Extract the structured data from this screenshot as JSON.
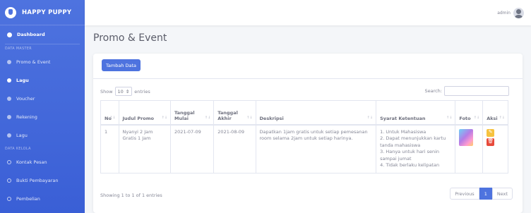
{
  "brand": {
    "name": "HAPPY PUPPY",
    "icon": "dog-icon"
  },
  "sidebar": {
    "dashboard": "Dashboard",
    "section_master": "DATA MASTER",
    "items": [
      "Promo & Event",
      "Lagu",
      "Voucher",
      "Rekening",
      "Lagu"
    ],
    "section_kelola": "DATA KELOLA",
    "kelola_items": [
      "Kontak Pesan",
      "Bukti Pembayaran",
      "Pembelian"
    ]
  },
  "topbar": {
    "user": "admin"
  },
  "page": {
    "title": "Promo & Event"
  },
  "toolbar": {
    "add_label": "Tambah Data"
  },
  "table_controls": {
    "show_label": "Show",
    "entries_value": "10",
    "entries_label": "entries",
    "search_label": "Search:"
  },
  "table": {
    "headers": [
      "No",
      "Judul Promo",
      "Tanggal Mulai",
      "Tanggal Akhir",
      "Deskripsi",
      "Syarat Ketentuan",
      "Foto",
      "Aksi"
    ],
    "rows": [
      {
        "no": "1",
        "judul": "Nyanyi 2 Jam Gratis 1 Jam",
        "mulai": "2021-07-09",
        "akhir": "2021-08-09",
        "deskripsi": "Dapatkan 1jam gratis untuk setiap pemesanan room selama 2jam untuk setiap harinya.",
        "syarat": [
          "1. Untuk Mahasiswa",
          "2. Dapat menunjukkan kartu tanda mahasiswa",
          "3. Hanya untuk hari senin sampai jumat",
          "4. Tidak berlaku kelipatan"
        ]
      }
    ]
  },
  "footer": {
    "info": "Showing 1 to 1 of 1 entries",
    "previous": "Previous",
    "page": "1",
    "next": "Next"
  },
  "colors": {
    "primary": "#4e73df",
    "edit": "#f6c23e",
    "delete": "#e74a3b"
  }
}
